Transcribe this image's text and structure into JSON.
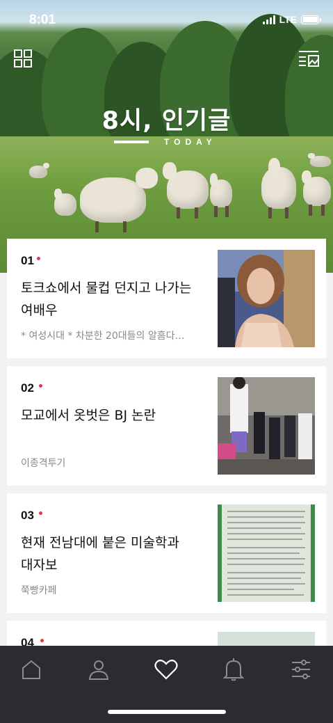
{
  "status_bar": {
    "time": "8:01",
    "network": "LTE"
  },
  "header": {
    "title": "8시, 인기글",
    "subtitle": "TODAY"
  },
  "icons": {
    "grid": "grid-icon",
    "menu": "list-image-icon"
  },
  "posts": [
    {
      "rank": "01",
      "title": "토크쇼에서 물컵 던지고 나가는 여배우",
      "source": "* 여성시대 *  차분한 20대들의 알흠다…"
    },
    {
      "rank": "02",
      "title": "모교에서 옷벗은 BJ 논란",
      "source": "이종격투기"
    },
    {
      "rank": "03",
      "title": "현재 전남대에 붙은 미술학과 대자보",
      "source": "쭉빵카페"
    },
    {
      "rank": "04",
      "title": "",
      "source": ""
    }
  ],
  "tabbar": {
    "items": [
      "home-icon",
      "profile-icon",
      "heart-icon",
      "bell-icon",
      "settings-sliders-icon"
    ],
    "active": "heart-icon"
  },
  "colors": {
    "accent_dot": "#e8344b",
    "tabbar_bg": "#2a2c31",
    "background": "#f1f2f4"
  }
}
